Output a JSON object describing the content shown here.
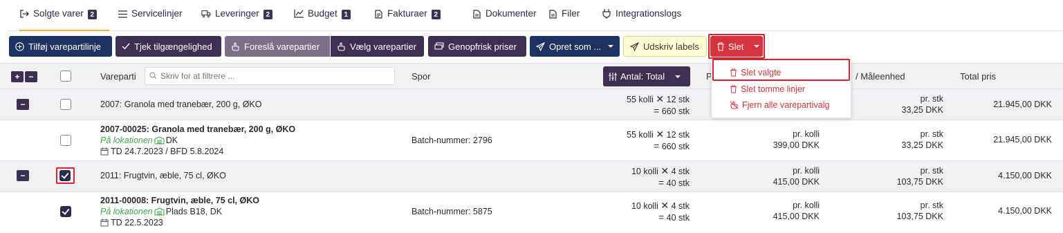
{
  "tabs": [
    {
      "label": "Solgte varer",
      "badge": "2",
      "icon": "sign-in-icon"
    },
    {
      "label": "Servicelinjer",
      "badge": "",
      "icon": "list-icon"
    },
    {
      "label": "Leveringer",
      "badge": "2",
      "icon": "truck-icon"
    },
    {
      "label": "Budget",
      "badge": "1",
      "icon": "chart-line-icon"
    },
    {
      "label": "Fakturaer",
      "badge": "2",
      "icon": "invoice-icon"
    },
    {
      "label": "Dokumenter",
      "badge": "",
      "icon": "document-icon"
    },
    {
      "label": "Filer",
      "badge": "",
      "icon": "file-icon"
    },
    {
      "label": "Integrationslogs",
      "badge": "",
      "icon": "plug-icon"
    }
  ],
  "toolbar": {
    "add_batch_line": "Tilføj varepartilinje",
    "check_availability": "Tjek tilgængelighed",
    "suggest_batches": "Foreslå varepartier",
    "choose_batches": "Vælg varepartier",
    "refresh_prices": "Genopfrisk priser",
    "create_as": "Opret som ...",
    "print_labels": "Udskriv labels",
    "delete": "Slet"
  },
  "delete_menu": {
    "delete_selected": "Slet valgte",
    "delete_empty_lines": "Slet tomme linjer",
    "remove_all_batches": "Fjern alle varepartivalg"
  },
  "table": {
    "header": {
      "expand": "+",
      "collapse": "−",
      "batch": "Vareparti",
      "filter_placeholder": "Skriv for at filtrere ...",
      "trace": "Spor",
      "quantity_button": "Antal: Total",
      "price_col_partial": "P",
      "unit": "/ Måleenhed",
      "total_price": "Total pris"
    },
    "rows": [
      {
        "type": "group",
        "toggle": "−",
        "checked": false,
        "title": "2007: Granola med tranebær, 200 g, ØKO",
        "qty_line1": "55 kolli",
        "qty_line1b": "12 stk",
        "qty_line2": "660 stk",
        "unit_line1": "pr. stk",
        "unit_line2": "33,25 DKK",
        "total": "21.945,00 DKK"
      },
      {
        "type": "item",
        "checked": false,
        "title": "2007-00025: Granola med tranebær, 200 g, ØKO",
        "location_label": "På lokationen",
        "location": "DK",
        "dates": "TD 24.7.2023 / BFD 5.8.2024",
        "trace": "Batch-nummer: 2796",
        "qty_line1": "55 kolli",
        "qty_line1b": "12 stk",
        "qty_line2": "660 stk",
        "price_line1": "pr. kolli",
        "price_line2": "399,00 DKK",
        "unit_line1": "pr. stk",
        "unit_line2": "33,25 DKK",
        "total": "21.945,00 DKK"
      },
      {
        "type": "group",
        "toggle": "−",
        "checked": true,
        "title": "2011: Frugtvin, æble, 75 cl, ØKO",
        "qty_line1": "10 kolli",
        "qty_line1b": "4 stk",
        "qty_line2": "40 stk",
        "price_line1": "pr. kolli",
        "price_line2": "415,00 DKK",
        "unit_line1": "pr. stk",
        "unit_line2": "103,75 DKK",
        "total": "4.150,00 DKK"
      },
      {
        "type": "item",
        "checked": true,
        "title": "2011-00008: Frugtvin, æble, 75 cl, ØKO",
        "location_label": "På lokationen",
        "location": "Plads B18, DK",
        "dates": "TD 22.5.2023",
        "trace": "Batch-nummer: 5875",
        "qty_line1": "10 kolli",
        "qty_line1b": "4 stk",
        "qty_line2": "40 stk",
        "price_line1": "pr. kolli",
        "price_line2": "415,00 DKK",
        "unit_line1": "pr. stk",
        "unit_line2": "103,75 DKK",
        "total": "4.150,00 DKK"
      }
    ]
  },
  "colors": {
    "navy": "#1e3362",
    "purple": "#3d3052",
    "red": "#d5343d",
    "tab_underline": "#e9b341",
    "green": "#3fa84a"
  }
}
